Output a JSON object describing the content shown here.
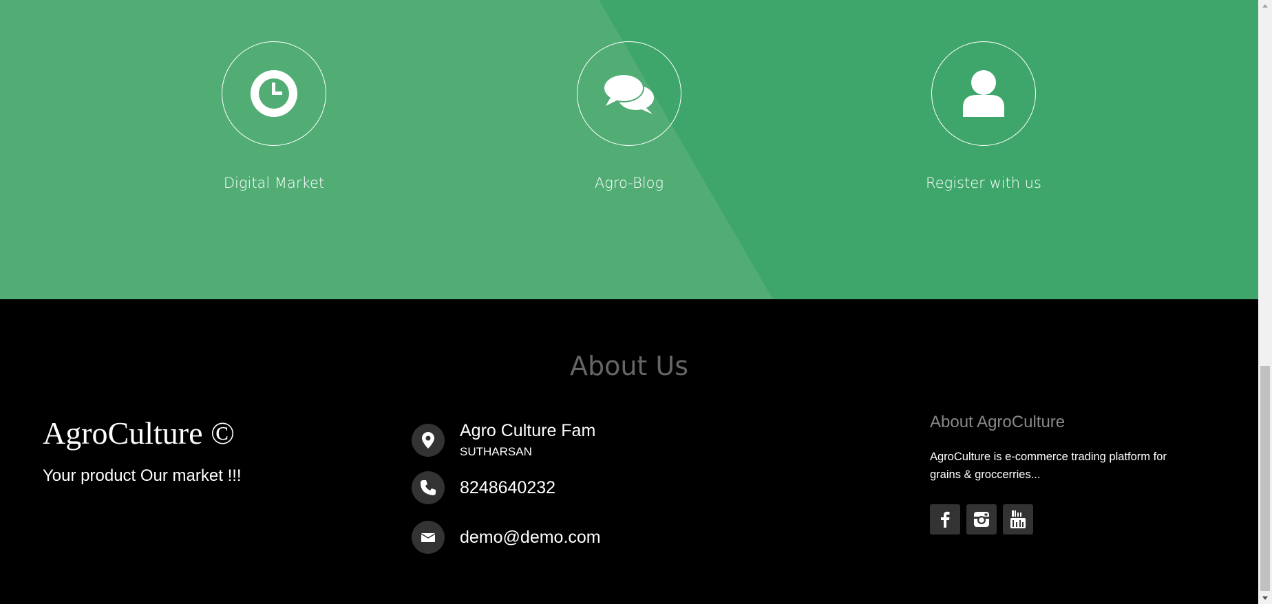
{
  "features": [
    {
      "label": "Digital Market",
      "icon": "clock-icon"
    },
    {
      "label": "Agro-Blog",
      "icon": "comments-icon"
    },
    {
      "label": "Register with us",
      "icon": "user-icon"
    }
  ],
  "footer": {
    "heading": "About Us",
    "brand": "AgroCulture ©",
    "tagline": "Your product Our market !!!",
    "contact": {
      "name": "Agro Culture Fam",
      "person": "SUTHARSAN",
      "phone": "8248640232",
      "email": "demo@demo.com"
    },
    "about_company": {
      "title": "About AgroCulture",
      "text": "AgroCulture is e-commerce trading platform for grains & groccerries..."
    },
    "socials": [
      "facebook-icon",
      "instagram-icon",
      "youtube-icon"
    ]
  },
  "colors": {
    "green_dark": "#3ea66a",
    "green_light": "#52ad75",
    "footer_bg": "#000000",
    "icon_bg": "#333333"
  }
}
